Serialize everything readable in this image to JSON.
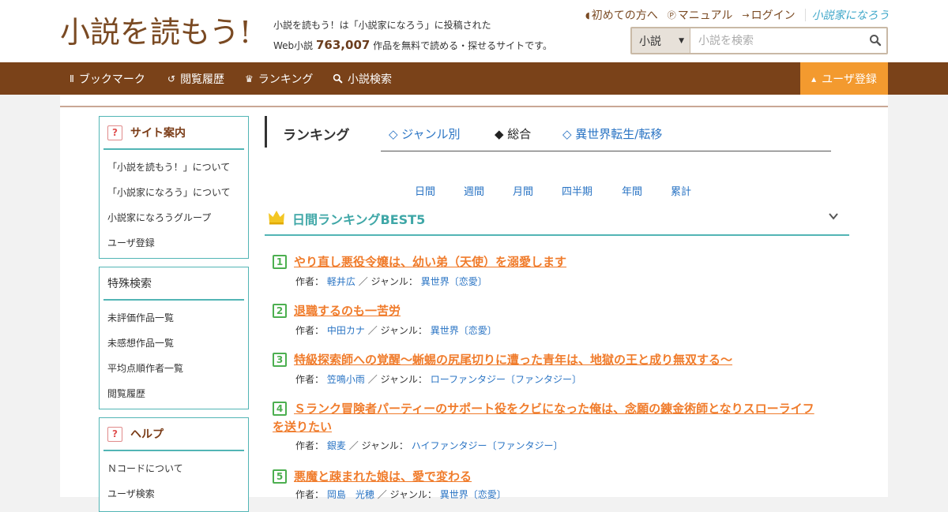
{
  "header": {
    "logo_text": "小説を読もう!",
    "tagline_line1": "小説を読もう！は「小説家になろう」に投稿された",
    "tagline_prefix": "Web小説",
    "work_count": "763,007",
    "tagline_suffix": "作品を無料で読める・探せるサイトです。",
    "links": [
      {
        "label": "初めての方へ",
        "icon": "beginner-icon"
      },
      {
        "label": "マニュアル",
        "icon": "help-circle-icon"
      },
      {
        "label": "ログイン",
        "icon": "login-icon"
      }
    ],
    "partner_logo_text": "小説家になろう",
    "search": {
      "category": "小説",
      "placeholder": "小説を検索"
    }
  },
  "nav": {
    "items": [
      {
        "label": "ブックマーク",
        "icon": "bookmark-icon"
      },
      {
        "label": "閲覧履歴",
        "icon": "history-icon"
      },
      {
        "label": "ランキング",
        "icon": "crown-icon"
      },
      {
        "label": "小説検索",
        "icon": "search-icon"
      }
    ],
    "register": "ユーザ登録"
  },
  "sidebar": {
    "site_guide": {
      "title": "サイト案内",
      "items": [
        "「小説を読もう！」について",
        "「小説家になろう」について",
        "小説家になろうグループ",
        "ユーザ登録"
      ]
    },
    "special_search": {
      "title": "特殊検索",
      "items": [
        "未評価作品一覧",
        "未感想作品一覧",
        "平均点順作者一覧",
        "閲覧履歴"
      ]
    },
    "help": {
      "title": "ヘルプ",
      "items": [
        "Ｎコードについて",
        "ユーザ検索"
      ]
    }
  },
  "ranking": {
    "title": "ランキング",
    "tabs": [
      "◇ ジャンル別",
      "◆ 総合",
      "◇ 異世界転生/転移"
    ],
    "periods": [
      "日間",
      "週間",
      "月間",
      "四半期",
      "年間",
      "累計"
    ],
    "best_title": "日間ランキングBEST5",
    "author_label": "作者：",
    "genre_label": "／ ジャンル：",
    "items": [
      {
        "rank": "1",
        "title": "やり直し悪役令嬢は、幼い弟（天使）を溺愛します",
        "author": "軽井広",
        "genre": "異世界〔恋愛〕"
      },
      {
        "rank": "2",
        "title": "退職するのも一苦労",
        "author": "中田カナ",
        "genre": "異世界〔恋愛〕"
      },
      {
        "rank": "3",
        "title": "特級探索師への覚醒～蜥蜴の尻尾切りに遭った青年は、地獄の王と成り無双する～",
        "author": "笠鳴小雨",
        "genre": "ローファンタジー〔ファンタジー〕"
      },
      {
        "rank": "4",
        "title": "Ｓランク冒険者パーティーのサポート役をクビになった俺は、念願の錬金術師となりスローライフを送りたい",
        "author": "銀麦",
        "genre": "ハイファンタジー〔ファンタジー〕"
      },
      {
        "rank": "5",
        "title": "悪魔と疎まれた娘は、愛で変わる",
        "author": "岡島　光穂",
        "genre": "異世界〔恋愛〕"
      }
    ]
  },
  "colors": {
    "brand_brown": "#7a4219",
    "register_orange": "#f39a2f",
    "teal": "#52b5b5",
    "title_orange": "#f07c2c",
    "link_blue": "#2a74c4"
  }
}
